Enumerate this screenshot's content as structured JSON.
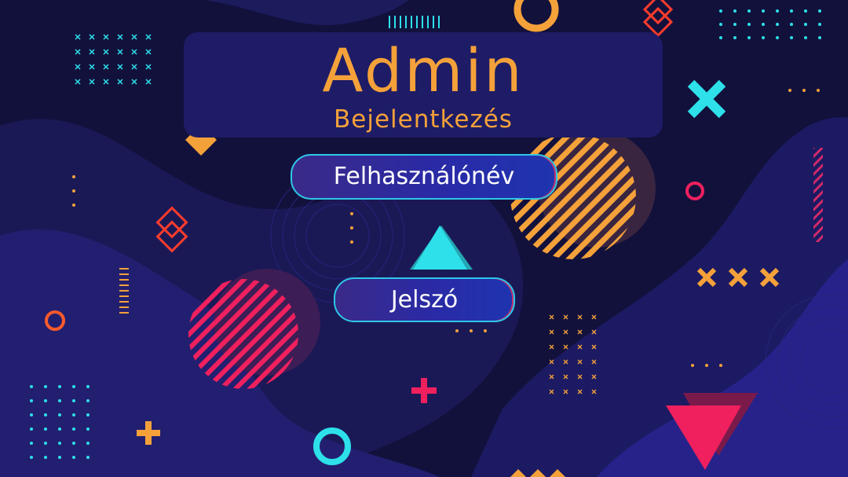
{
  "login": {
    "title": "Admin",
    "subtitle": "Bejelentkezés",
    "username_label": "Felhasználónév",
    "password_label": "Jelszó"
  },
  "colors": {
    "background": "#12113c",
    "panel": "#1e1c66",
    "accent_orange": "#f5a13a",
    "accent_cyan": "#2de0ea",
    "accent_pink": "#f0205e",
    "field_border": "#2ec7e6"
  }
}
